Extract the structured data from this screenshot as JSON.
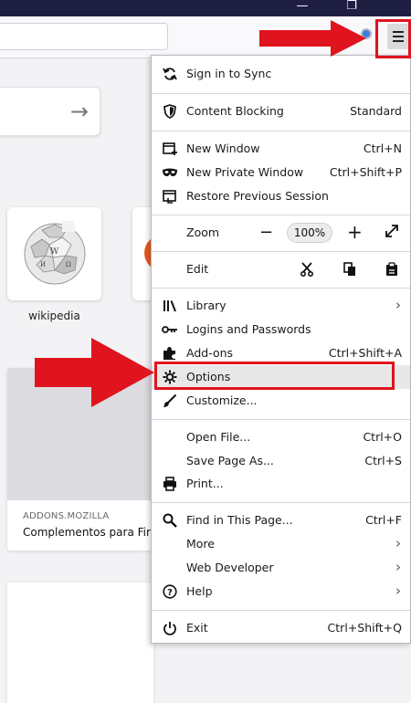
{
  "window": {
    "minimize_glyph": "—",
    "restore_glyph": "❐",
    "accent": "#1f1f44"
  },
  "toolbar": {
    "menu_icon": "hamburger-menu-icon"
  },
  "newtab": {
    "search_arrow": "→",
    "top_site_label": "wikipedia",
    "card_source": "ADDONS.MOZILLA",
    "card_title": "Complementos para Firefox"
  },
  "menu": {
    "sign_in": "Sign in to Sync",
    "content_blocking": "Content Blocking",
    "content_blocking_value": "Standard",
    "new_window": "New Window",
    "new_window_shortcut": "Ctrl+N",
    "new_private_window": "New Private Window",
    "new_private_window_shortcut": "Ctrl+Shift+P",
    "restore_session": "Restore Previous Session",
    "zoom_label": "Zoom",
    "zoom_minus": "−",
    "zoom_value": "100%",
    "zoom_plus": "+",
    "edit_label": "Edit",
    "library": "Library",
    "logins": "Logins and Passwords",
    "addons": "Add-ons",
    "addons_shortcut": "Ctrl+Shift+A",
    "options": "Options",
    "customize": "Customize...",
    "open_file": "Open File...",
    "open_file_shortcut": "Ctrl+O",
    "save_page": "Save Page As...",
    "save_page_shortcut": "Ctrl+S",
    "print": "Print...",
    "find": "Find in This Page...",
    "find_shortcut": "Ctrl+F",
    "more": "More",
    "web_developer": "Web Developer",
    "help": "Help",
    "exit": "Exit",
    "exit_shortcut": "Ctrl+Shift+Q",
    "submenu_chevron": "›"
  },
  "annotations": {
    "highlight_color": "#e0141e"
  }
}
